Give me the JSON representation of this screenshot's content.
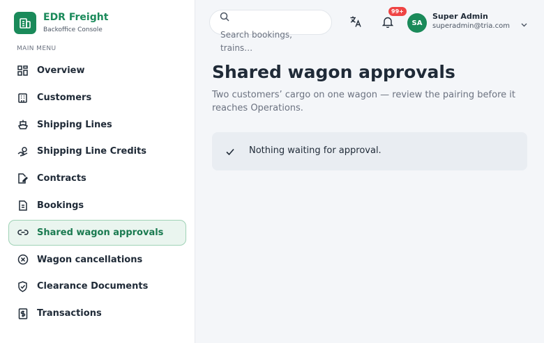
{
  "brand": {
    "name": "EDR Freight",
    "subtitle": "Backoffice Console"
  },
  "sidebar": {
    "section_header": "MAIN MENU",
    "items": [
      {
        "label": "Overview",
        "icon": "grid-icon",
        "active": false
      },
      {
        "label": "Customers",
        "icon": "building-icon",
        "active": false
      },
      {
        "label": "Shipping Lines",
        "icon": "ship-icon",
        "active": false
      },
      {
        "label": "Shipping Line Credits",
        "icon": "hand-coins-icon",
        "active": false
      },
      {
        "label": "Contracts",
        "icon": "contract-icon",
        "active": false
      },
      {
        "label": "Bookings",
        "icon": "document-icon",
        "active": false
      },
      {
        "label": "Shared wagon approvals",
        "icon": "link-icon",
        "active": true
      },
      {
        "label": "Wagon cancellations",
        "icon": "x-circle-icon",
        "active": false
      },
      {
        "label": "Clearance Documents",
        "icon": "shield-check-icon",
        "active": false
      },
      {
        "label": "Transactions",
        "icon": "dollar-receipt-icon",
        "active": false
      }
    ]
  },
  "header": {
    "search_placeholder": "Search bookings, trains…",
    "notification_badge": "99+",
    "user": {
      "initials": "SA",
      "name": "Super Admin",
      "email": "superadmin@tria.com"
    }
  },
  "main": {
    "title": "Shared wagon approvals",
    "subtitle": "Two customers’ cargo on one wagon — review the pairing before it reaches Operations.",
    "empty_state": "Nothing waiting for approval."
  },
  "colors": {
    "accent": "#1a8a5a",
    "active_bg": "#eaf5ef",
    "badge": "#ef4444"
  }
}
